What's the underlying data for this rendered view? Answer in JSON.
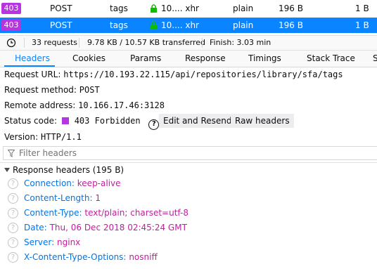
{
  "requests": [
    {
      "status": "403",
      "method": "POST",
      "domain": "tags",
      "file": "10.... xhr",
      "type": "plain",
      "transferred": "196 B",
      "size": "1 B",
      "selected": false
    },
    {
      "status": "403",
      "method": "POST",
      "domain": "tags",
      "file": "10.... xhr",
      "type": "plain",
      "transferred": "196 B",
      "size": "1 B",
      "selected": true
    }
  ],
  "summary": {
    "requests": "33 requests",
    "transferred": "9.78 KB / 10.57 KB transferred",
    "finish": "Finish: 3.03 min"
  },
  "tabs": [
    "Headers",
    "Cookies",
    "Params",
    "Response",
    "Timings",
    "Stack Trace",
    "S"
  ],
  "active_tab": "Headers",
  "details": {
    "url_label": "Request URL:",
    "url": "https://10.193.22.115/api/repositories/library/sfa/tags",
    "method_label": "Request method:",
    "method": "POST",
    "remote_label": "Remote address:",
    "remote": "10.166.17.46:3128",
    "status_label": "Status code:",
    "status": "403 Forbidden",
    "edit_resend": "Edit and Resend",
    "raw_headers": "Raw headers",
    "version_label": "Version:",
    "version": "HTTP/1.1"
  },
  "filter": {
    "placeholder": "Filter headers"
  },
  "response_headers": {
    "title": "Response headers (195 B)",
    "items": [
      {
        "name": "Connection:",
        "value": "keep-alive"
      },
      {
        "name": "Content-Length:",
        "value": "1"
      },
      {
        "name": "Content-Type:",
        "value": "text/plain; charset=utf-8"
      },
      {
        "name": "Date:",
        "value": "Thu, 06 Dec 2018 02:45:24 GMT"
      },
      {
        "name": "Server:",
        "value": "nginx"
      },
      {
        "name": "X-Content-Type-Options:",
        "value": "nosniff"
      }
    ]
  },
  "colors": {
    "status_403": "#b833e1",
    "selected_row": "#0a84ff",
    "header_name": "#0074e8",
    "header_value": "#c21d9e",
    "lock": "#12bc00"
  }
}
